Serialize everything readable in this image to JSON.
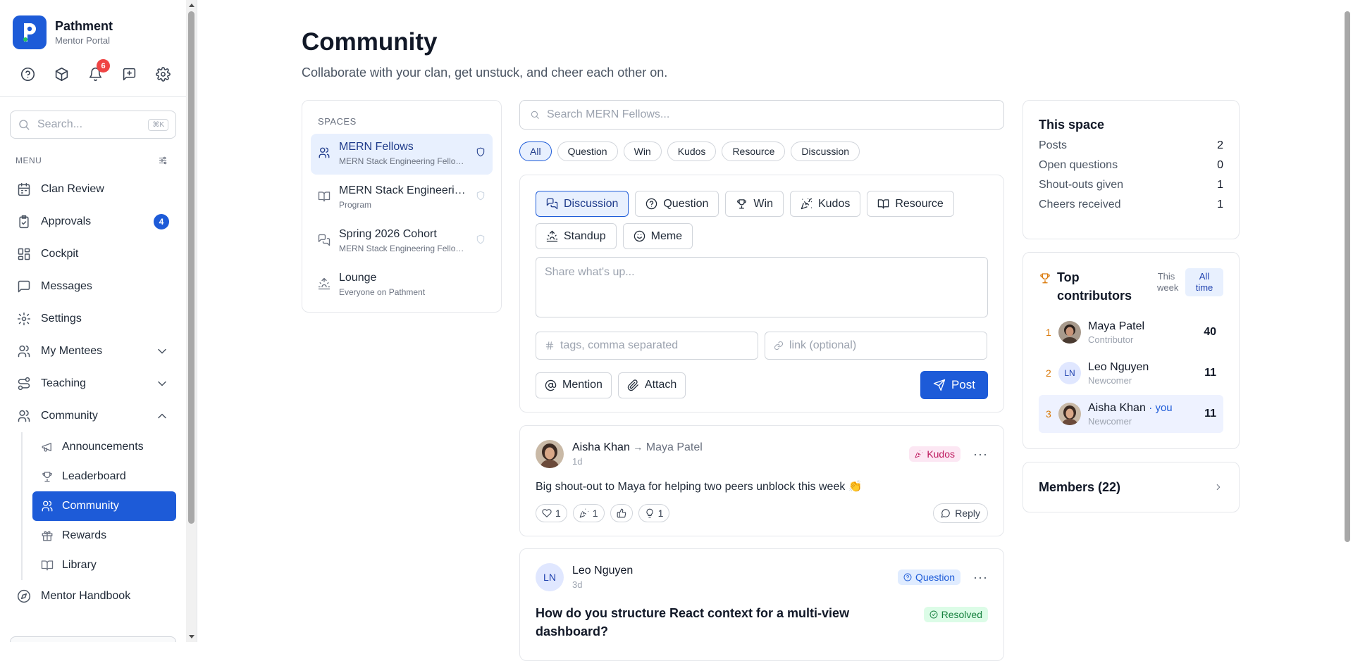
{
  "brand": {
    "name": "Pathment",
    "subtitle": "Mentor Portal",
    "color": "#1d5bd8"
  },
  "toolbar": {
    "notifications_count": "6"
  },
  "sidebar": {
    "search_placeholder": "Search...",
    "search_shortcut": "⌘K",
    "menu_label": "MENU",
    "items": [
      {
        "label": "Clan Review",
        "icon": "calendar-icon"
      },
      {
        "label": "Approvals",
        "icon": "clipboard-check-icon",
        "count": "4"
      },
      {
        "label": "Cockpit",
        "icon": "layout-grid-icon"
      },
      {
        "label": "Messages",
        "icon": "message-square-icon"
      },
      {
        "label": "Settings",
        "icon": "gear-icon"
      },
      {
        "label": "My Mentees",
        "icon": "users-icon"
      },
      {
        "label": "Teaching",
        "icon": "route-icon"
      },
      {
        "label": "Community",
        "icon": "users-icon"
      }
    ],
    "community_sub": [
      {
        "label": "Announcements",
        "icon": "megaphone-icon"
      },
      {
        "label": "Leaderboard",
        "icon": "trophy-icon"
      },
      {
        "label": "Community",
        "icon": "users-icon",
        "active": true
      },
      {
        "label": "Rewards",
        "icon": "gift-icon"
      },
      {
        "label": "Library",
        "icon": "book-icon"
      }
    ],
    "handbook": {
      "label": "Mentor Handbook",
      "icon": "compass-icon"
    }
  },
  "page": {
    "title": "Community",
    "subtitle": "Collaborate with your clan, get unstuck, and cheer each other on."
  },
  "spaces": {
    "header": "SPACES",
    "items": [
      {
        "name": "MERN Fellows",
        "desc": "MERN Stack Engineering Fellowship",
        "icon": "users-icon",
        "active": true
      },
      {
        "name": "MERN Stack Engineering Program",
        "desc": "Program",
        "icon": "book-icon"
      },
      {
        "name": "Spring 2026 Cohort",
        "desc": "MERN Stack Engineering Fellowship",
        "icon": "messages-icon"
      },
      {
        "name": "Lounge",
        "desc": "Everyone on Pathment",
        "icon": "sunrise-icon"
      }
    ]
  },
  "feed": {
    "search_placeholder": "Search MERN Fellows...",
    "filters": [
      "All",
      "Question",
      "Win",
      "Kudos",
      "Resource",
      "Discussion"
    ],
    "active_filter": "All"
  },
  "composer": {
    "types": [
      {
        "label": "Discussion",
        "icon": "messages-icon",
        "active": true
      },
      {
        "label": "Question",
        "icon": "help-circle-icon"
      },
      {
        "label": "Win",
        "icon": "trophy-icon"
      },
      {
        "label": "Kudos",
        "icon": "party-popper-icon"
      },
      {
        "label": "Resource",
        "icon": "book-icon"
      },
      {
        "label": "Standup",
        "icon": "sunrise-icon"
      },
      {
        "label": "Meme",
        "icon": "smile-icon"
      }
    ],
    "placeholder": "Share what's up...",
    "tags_placeholder": "tags, comma separated",
    "link_placeholder": "link (optional)",
    "mention_label": "Mention",
    "attach_label": "Attach",
    "post_label": "Post"
  },
  "posts": [
    {
      "author": "Aisha Khan",
      "to": "Maya Patel",
      "time": "1d",
      "tag": "Kudos",
      "body": "Big shout-out to Maya for helping two peers unblock this week 👏",
      "reactions": [
        {
          "icon": "heart-icon",
          "count": "1"
        },
        {
          "icon": "party-popper-icon",
          "count": "1"
        },
        {
          "icon": "thumbs-up-icon",
          "count": ""
        },
        {
          "icon": "lightbulb-icon",
          "count": "1"
        }
      ],
      "reply_label": "Reply"
    },
    {
      "author": "Leo Nguyen",
      "initials": "LN",
      "time": "3d",
      "tag": "Question",
      "status": "Resolved",
      "title": "How do you structure React context for a multi-view dashboard?"
    }
  ],
  "stats": {
    "header": "This space",
    "rows": [
      {
        "label": "Posts",
        "value": "2"
      },
      {
        "label": "Open questions",
        "value": "0"
      },
      {
        "label": "Shout-outs given",
        "value": "1"
      },
      {
        "label": "Cheers received",
        "value": "1"
      }
    ]
  },
  "top_contributors": {
    "header": "Top contributors",
    "toggle": [
      "This week",
      "All time"
    ],
    "rows": [
      {
        "rank": "1",
        "name": "Maya Patel",
        "role": "Contributor",
        "score": "40"
      },
      {
        "rank": "2",
        "name": "Leo Nguyen",
        "initials": "LN",
        "role": "Newcomer",
        "score": "11"
      },
      {
        "rank": "3",
        "name": "Aisha Khan",
        "you": "· you",
        "role": "Newcomer",
        "score": "11"
      }
    ]
  },
  "members": {
    "label": "Members (22)"
  }
}
